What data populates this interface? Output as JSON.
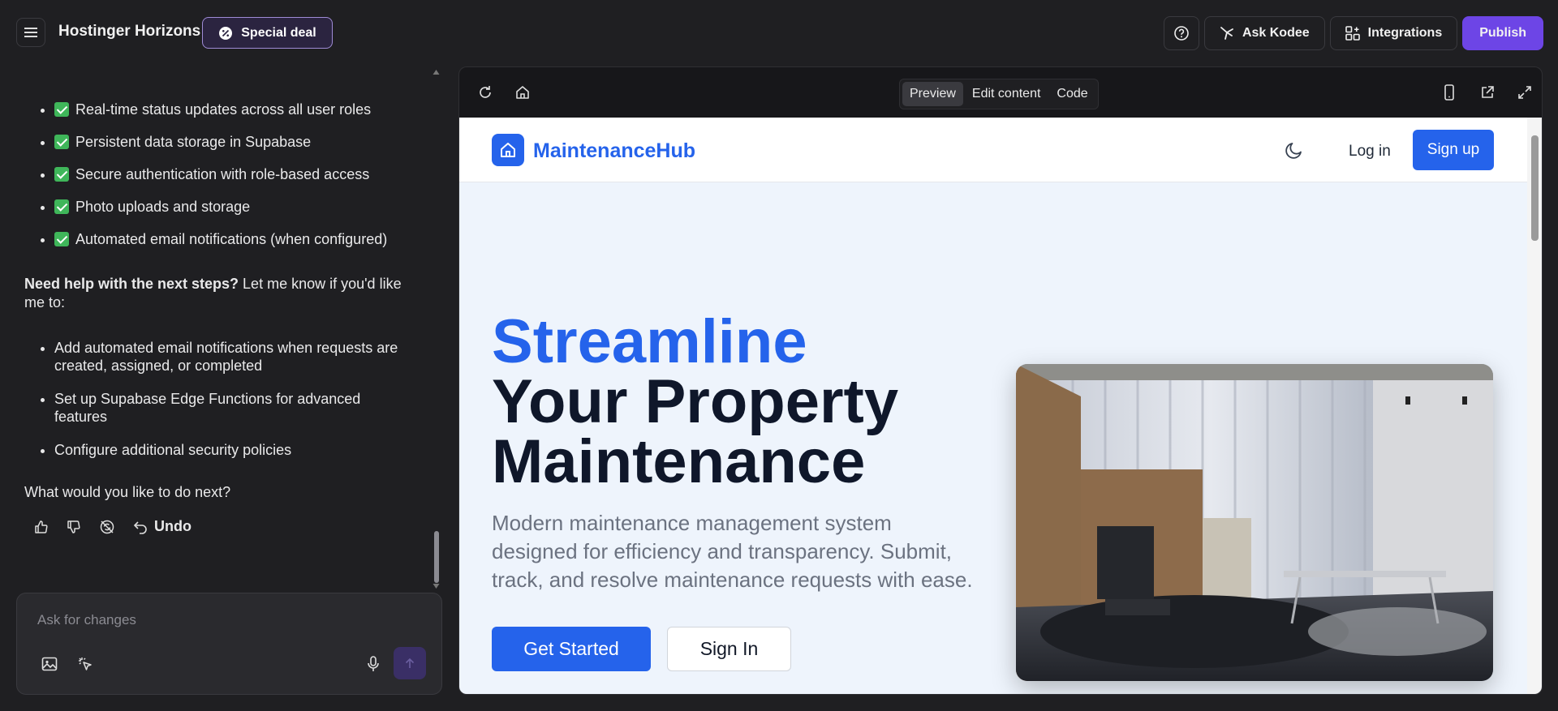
{
  "topbar": {
    "app_title": "Hostinger Horizons",
    "deal_label": "Special deal",
    "ask_label": "Ask Kodee",
    "integrations_label": "Integrations",
    "publish_label": "Publish"
  },
  "chat": {
    "features": [
      "Real-time status updates across all user roles",
      "Persistent data storage in Supabase",
      "Secure authentication with role-based access",
      "Photo uploads and storage",
      "Automated email notifications (when configured)"
    ],
    "help_bold": "Need help with the next steps?",
    "help_rest": " Let me know if you'd like me to:",
    "next_steps": [
      "Add automated email notifications when requests are created, assigned, or completed",
      "Set up Supabase Edge Functions for advanced features",
      "Configure additional security policies"
    ],
    "question": "What would you like to do next?",
    "undo_label": "Undo"
  },
  "input": {
    "placeholder": "Ask for changes"
  },
  "preview": {
    "tabs": [
      "Preview",
      "Edit content",
      "Code"
    ],
    "active_tab": "Preview"
  },
  "site": {
    "logo_text": "MaintenanceHub",
    "login_label": "Log in",
    "signup_label": "Sign up",
    "hero_accent": "Streamline",
    "hero_line2": "Your Property",
    "hero_line3": "Maintenance",
    "hero_sub": "Modern maintenance management system designed for efficiency and transparency. Submit, track, and resolve maintenance requests with ease.",
    "cta_primary": "Get Started",
    "cta_secondary": "Sign In"
  },
  "colors": {
    "brand_purple": "#6d45e6",
    "site_blue": "#2563eb",
    "check_green": "#3fb65a"
  }
}
